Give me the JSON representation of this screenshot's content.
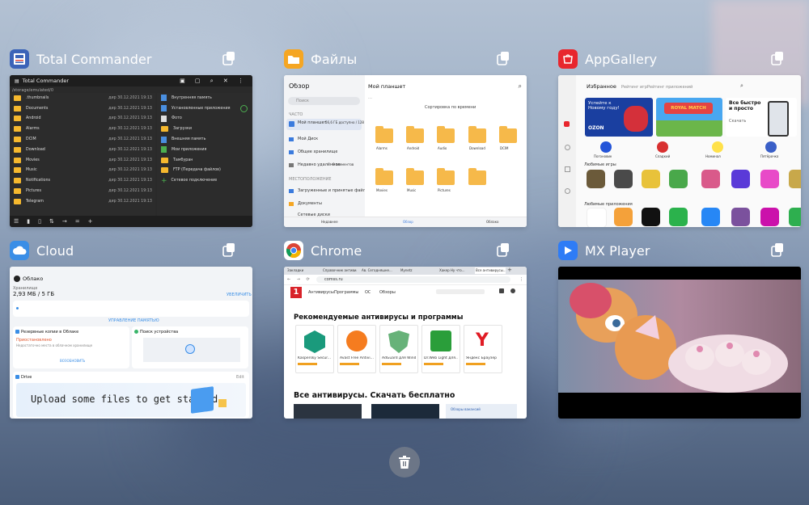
{
  "apps": {
    "total_commander": {
      "title": "Total Commander",
      "window_title": "Total Commander",
      "path": "/storage/emulated/0",
      "left_files": [
        ".thumbnails",
        "Documents",
        "Android",
        "Alarms",
        "DCIM",
        "Download",
        "Movies",
        "Music",
        "Notifications",
        "Pictures",
        "Telegram"
      ],
      "left_dates": [
        "дир 30.12.2021 19:13",
        "дир 30.12.2021 19:13",
        "дир 30.12.2021 19:13",
        "дир 30.12.2021 19:13",
        "дир 30.12.2021 19:13",
        "дир 30.12.2021 19:13",
        "дир 30.12.2021 19:13",
        "дир 30.12.2021 19:13",
        "дир 30.12.2021 19:13",
        "дир 30.12.2021 19:13",
        "дир 30.12.2021 19:13"
      ],
      "right_items": [
        "Внутренняя память",
        "Установленные приложения",
        "Фото",
        "Загрузки",
        "Внешняя память",
        "Мои приложения",
        "Тамбуран",
        "FTP (Передача файлов)",
        "Сетевое подключение"
      ]
    },
    "files": {
      "title": "Файлы",
      "sidebar_title": "Обзор",
      "search_placeholder": "Поиск",
      "section_recent": "ЧАСТО",
      "my_tablet": "Мой планшет",
      "my_tablet_sub": "56,6 ГБ доступно / 128 ГБ",
      "my_disk": "Мой Диск",
      "shared": "Общее хранилище",
      "recently_deleted": "Недавно удалённое",
      "recently_deleted_count": "0 элементов",
      "section_places": "МЕСТОПОЛОЖЕНИЕ",
      "downloads": "Загруженные и принятые файлы",
      "docs": "Документы",
      "other": "Сетевые диски",
      "main_title": "Мой планшет",
      "sort": "Сортировка по времени",
      "folders": [
        "Alarms",
        "Android",
        "Audio",
        "Download",
        "DCIM",
        "Movies",
        "Music",
        "Pictures"
      ],
      "nav": [
        "Недавнее",
        "Обзор",
        "Облако"
      ]
    },
    "appgallery": {
      "title": "AppGallery",
      "tabs": [
        "Избранное",
        "Рейтинг игр",
        "Рейтинг приложений"
      ],
      "banner1": "Успейте к Новому году!",
      "banner1_brand": "OZON",
      "banner2_brand": "ROYAL MATCH",
      "banner3": "Все быстро и просто",
      "banner3_sub": "Скачать",
      "apps_row": [
        "Погоновик",
        "Сладкий",
        "Номинал",
        "Пятёрочка",
        "Пиперс"
      ],
      "section_games": "Любимые игры",
      "section_apps": "Любимые приложения"
    },
    "cloud": {
      "title": "Cloud",
      "header": "Облако",
      "storage_label": "Хранилище",
      "storage_value": "2,93 МБ / 5 ГБ",
      "upgrade": "УВЕЛИЧИТЬ",
      "manage": "УПРАВЛЕНИЕ ПАМЯТЬЮ",
      "backup_title": "Резервные копии в Облаке",
      "backup_status": "Приостановлено",
      "backup_desc": "Недостаточно места в облачном хранилище",
      "backup_link": "ВОЗОБНОВИТЬ",
      "find_device": "Поиск устройства",
      "drive": "Drive",
      "drive_edit": "Edit",
      "upload_text": "Upload some files to get started"
    },
    "chrome": {
      "title": "Chrome",
      "tabs": [
        "Закладки",
        "Справочник антиви...",
        "Ав. Сегодняшне...",
        "Mynetz",
        "Хакер Ну что...",
        "Все антивирусы..."
      ],
      "url": "comss.ru",
      "menu": [
        "Антивирусы",
        "Программы",
        "ОС",
        "Обзоры"
      ],
      "heading1": "Рекомендуемые антивирусы и программы",
      "products": [
        "Kaspersky Secur...",
        "Avast Free Antivi...",
        "AdGuard для Wind...",
        "Dr.Web Light для...",
        "Яндекс Браузер"
      ],
      "heading2": "Все антивирусы. Скачать бесплатно",
      "side_box": "Обзоры вакансий"
    },
    "mxplayer": {
      "title": "MX Player"
    }
  },
  "colors": {
    "tc_icon": "#3b63b8",
    "files_icon": "#f5a623",
    "appgallery_icon": "#e8262d",
    "cloud_icon": "#3a8ee6",
    "chrome_icon": "#ffffff",
    "mx_icon": "#2e7cf6"
  },
  "trash_button": "clear-all"
}
